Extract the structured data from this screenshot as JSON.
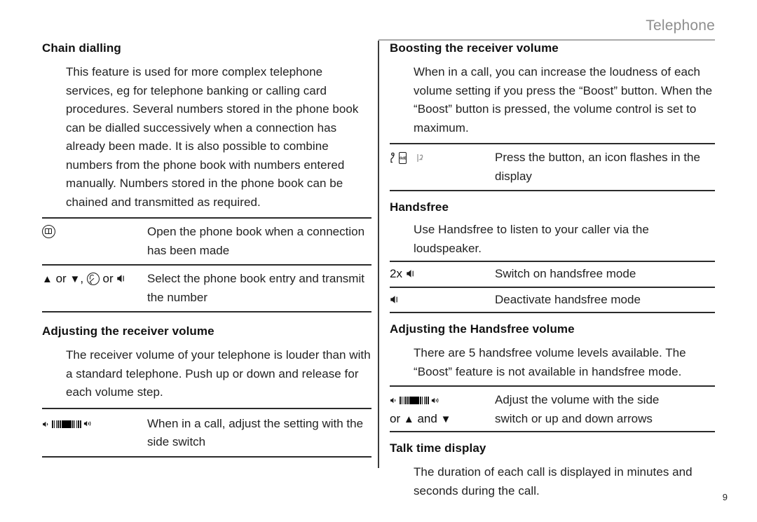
{
  "header": {
    "title": "Telephone"
  },
  "page_number": "9",
  "left_column": {
    "sections": [
      {
        "title": "Chain dialling",
        "paragraphs": [
          "This feature is used for more complex telephone services, eg for telephone banking or calling card procedures. Several numbers stored in the phone book can be dialled successively when a connection has already been made. It is also possible to combine numbers from the phone book with numbers entered manually. Numbers stored in the phone book can be chained and transmitted as required."
        ],
        "rows": [
          {
            "icons": [
              "phonebook-icon"
            ],
            "icon_text": "",
            "text": "Open the phone book when a connection has been made"
          },
          {
            "icons": [
              "up-triangle-icon",
              "down-triangle-icon",
              "call-icon",
              "speaker-icon"
            ],
            "icon_text_parts": [
              "▲",
              " or ",
              "▼",
              ", ",
              "call",
              " or ",
              "speaker"
            ],
            "text": "Select the phone book entry and transmit the number"
          }
        ]
      },
      {
        "title": "Adjusting the receiver volume",
        "paragraphs": [
          "The receiver volume of your telephone is louder than with a standard telephone. Push up or down and release for each volume step."
        ],
        "rows": [
          {
            "icons": [
              "volume-slider-icon"
            ],
            "text": "When in a call, adjust the setting with the side switch"
          }
        ]
      }
    ]
  },
  "right_column": {
    "sections": [
      {
        "title": "Boosting the receiver volume",
        "paragraphs": [
          "When in a call, you can increase the loudness of each volume setting if you press the “Boost” button. When the “Boost” button is pressed, the volume control is set to maximum."
        ],
        "rows": [
          {
            "icons": [
              "boost-button-icon",
              "boost-flashing-icon"
            ],
            "text": "Press the button, an icon flashes in the display"
          }
        ]
      },
      {
        "title": "Handsfree",
        "paragraphs": [
          "Use Handsfree to listen to your caller via the loudspeaker."
        ],
        "rows": [
          {
            "icons": [
              "speaker-icon"
            ],
            "prefix": "2x",
            "text": "Switch on handsfree mode"
          },
          {
            "icons": [
              "speaker-icon"
            ],
            "prefix": "",
            "text": "Deactivate handsfree mode"
          }
        ]
      },
      {
        "title": "Adjusting the Handsfree volume",
        "paragraphs": [
          "There are 5 handsfree volume levels available. The “Boost” feature is not available in handsfree mode."
        ],
        "rows": [
          {
            "icons": [
              "volume-slider-icon",
              "up-triangle-icon",
              "down-triangle-icon"
            ],
            "second_line_pre": "or",
            "second_line_mid": "and",
            "text_line1": "Adjust the volume with the side",
            "text_line2": "switch or up and down arrows"
          }
        ]
      },
      {
        "title": "Talk time display",
        "paragraphs": [
          "The duration of each call is displayed in minutes and seconds during the call."
        ],
        "rows": []
      }
    ]
  },
  "glyphs": {
    "up_triangle": "▲",
    "down_triangle": "▼",
    "or_word": "or",
    "and_word": "and",
    "comma": ",",
    "times_two": "2x",
    "boost_db_label": "30dB"
  }
}
